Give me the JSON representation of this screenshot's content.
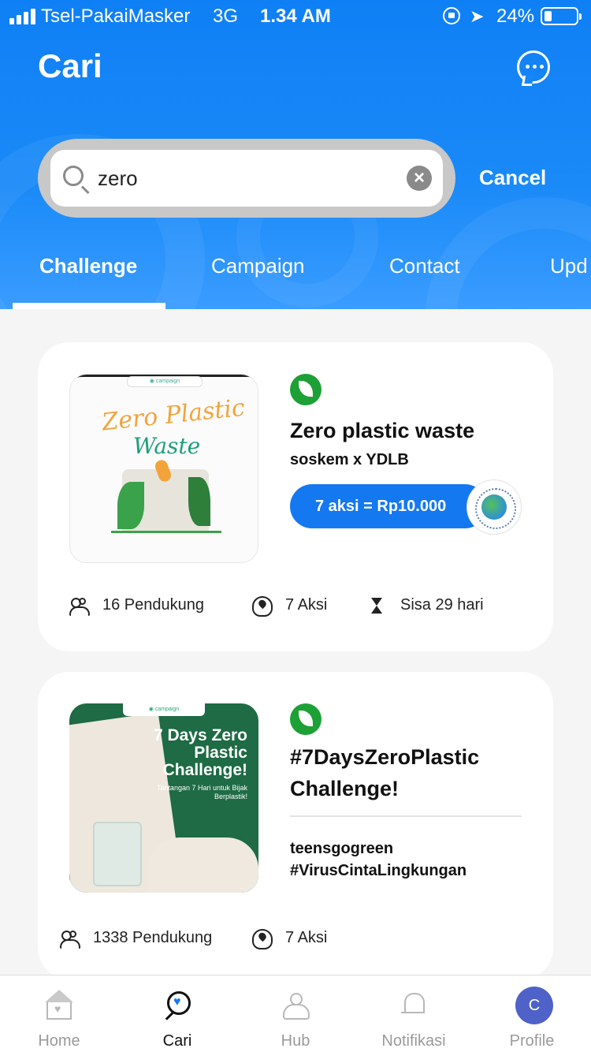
{
  "status_bar": {
    "carrier": "Tsel-PakaiMasker",
    "network": "3G",
    "time": "1.34 AM",
    "battery": "24%"
  },
  "header": {
    "title": "Cari"
  },
  "search": {
    "value": "zero",
    "placeholder": "",
    "cancel_label": "Cancel"
  },
  "tabs": [
    {
      "label": "Challenge",
      "active": true
    },
    {
      "label": "Campaign",
      "active": false
    },
    {
      "label": "Contact",
      "active": false
    },
    {
      "label": "Upd",
      "active": false
    }
  ],
  "results": [
    {
      "title": "Zero plastic waste",
      "owner": "soskem x YDLB",
      "donation": "7 aksi = Rp10.000",
      "thumb_title_1": "Zero Plastic",
      "thumb_title_2": "Waste",
      "stats": {
        "supporters": "16 Pendukung",
        "actions": "7 Aksi",
        "remaining": "Sisa 29 hari"
      }
    },
    {
      "title": "#7DaysZeroPlastic Challenge!",
      "owner": "teensgogreen #VirusCintaLingkungan",
      "thumb_title": "7 Days Zero Plastic Challenge!",
      "thumb_subtitle": "Tantangan 7 Hari untuk Bijak Berplastik!",
      "stats": {
        "supporters": "1338 Pendukung",
        "actions": "7 Aksi"
      }
    }
  ],
  "bottom_nav": [
    {
      "label": "Home",
      "active": false
    },
    {
      "label": "Cari",
      "active": true
    },
    {
      "label": "Hub",
      "active": false
    },
    {
      "label": "Notifikasi",
      "active": false
    },
    {
      "label": "Profile",
      "active": false
    }
  ],
  "profile_initial": "C",
  "colors": {
    "primary": "#1478f0",
    "header_gradient_top": "#0f7ff5",
    "category_green": "#1da035",
    "avatar": "#4f62c8"
  }
}
